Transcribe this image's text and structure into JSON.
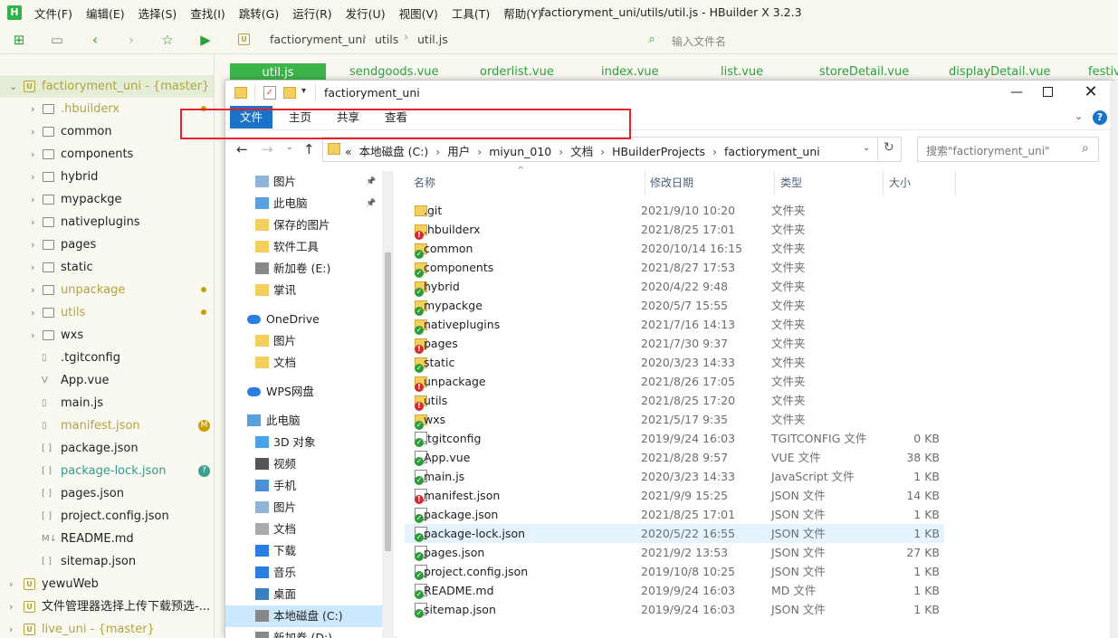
{
  "hbuilder": {
    "menu": [
      "文件(F)",
      "编辑(E)",
      "选择(S)",
      "查找(I)",
      "跳转(G)",
      "运行(R)",
      "发行(U)",
      "视图(V)",
      "工具(T)",
      "帮助(Y)"
    ],
    "title": "factioryment_uni/utils/util.js - HBuilder X 3.2.3",
    "breadcrumb": [
      "factioryment_uni",
      "utils",
      "util.js"
    ],
    "file_search_placeholder": "输入文件名",
    "editor_tabs": [
      "util.js",
      "sendgoods.vue",
      "orderlist.vue",
      "index.vue",
      "list.vue",
      "storeDetail.vue",
      "displayDetail.vue",
      "festiv"
    ],
    "sidebar": [
      {
        "label": "factioryment_uni - {master}",
        "kind": "project",
        "open": true,
        "color": "#b3a33f",
        "indent": 0
      },
      {
        "label": ".hbuilderx",
        "kind": "folder",
        "indent": 1,
        "dot": true,
        "color": "#b3a33f"
      },
      {
        "label": "common",
        "kind": "folder",
        "indent": 1
      },
      {
        "label": "components",
        "kind": "folder",
        "indent": 1
      },
      {
        "label": "hybrid",
        "kind": "folder",
        "indent": 1
      },
      {
        "label": "mypackge",
        "kind": "folder",
        "indent": 1
      },
      {
        "label": "nativeplugins",
        "kind": "folder",
        "indent": 1
      },
      {
        "label": "pages",
        "kind": "folder",
        "indent": 1
      },
      {
        "label": "static",
        "kind": "folder",
        "indent": 1
      },
      {
        "label": "unpackage",
        "kind": "folder",
        "indent": 1,
        "dot": true,
        "color": "#b3a33f"
      },
      {
        "label": "utils",
        "kind": "folder",
        "indent": 1,
        "dot": true,
        "color": "#b3a33f"
      },
      {
        "label": "wxs",
        "kind": "folder",
        "indent": 1
      },
      {
        "label": ".tgitconfig",
        "kind": "file",
        "indent": 1
      },
      {
        "label": "App.vue",
        "kind": "file",
        "indent": 1,
        "glyph": "V"
      },
      {
        "label": "main.js",
        "kind": "file",
        "indent": 1
      },
      {
        "label": "manifest.json",
        "kind": "file",
        "indent": 1,
        "color": "#b3a33f",
        "badge": "M",
        "badge_color": "#c8a000"
      },
      {
        "label": "package.json",
        "kind": "file",
        "indent": 1,
        "glyph": "[ ]"
      },
      {
        "label": "package-lock.json",
        "kind": "file",
        "indent": 1,
        "glyph": "[ ]",
        "color": "#2e9a8a",
        "badge": "?",
        "badge_color": "#3aa090"
      },
      {
        "label": "pages.json",
        "kind": "file",
        "indent": 1,
        "glyph": "[ ]"
      },
      {
        "label": "project.config.json",
        "kind": "file",
        "indent": 1,
        "glyph": "[ ]"
      },
      {
        "label": "README.md",
        "kind": "file",
        "indent": 1,
        "glyph": "M↓"
      },
      {
        "label": "sitemap.json",
        "kind": "file",
        "indent": 1,
        "glyph": "[ ]"
      },
      {
        "label": "yewuWeb",
        "kind": "project",
        "indent": 0
      },
      {
        "label": "文件管理器选择上传下载预选-...",
        "kind": "project",
        "indent": 0
      },
      {
        "label": "live_uni - {master}",
        "kind": "project",
        "indent": 0,
        "color": "#b3a33f"
      }
    ]
  },
  "explorer": {
    "title": "factioryment_uni",
    "ribbon_tabs": [
      "文件",
      "主页",
      "共享",
      "查看"
    ],
    "path": [
      "« ",
      "本地磁盘 (C:)",
      "用户",
      "miyun_010",
      "文档",
      "HBuilderProjects",
      "factioryment_uni"
    ],
    "search_placeholder": "搜索\"factioryment_uni\"",
    "columns": {
      "name": "名称",
      "date": "修改日期",
      "type": "类型",
      "size": "大小"
    },
    "nav": [
      {
        "label": "图片",
        "icon": "pictures-icon",
        "indent": 1,
        "pin": true
      },
      {
        "label": "此电脑",
        "icon": "pc-icon",
        "indent": 1,
        "pin": true
      },
      {
        "label": "保存的图片",
        "icon": "folder-icon",
        "indent": 1
      },
      {
        "label": "软件工具",
        "icon": "folder-icon",
        "indent": 1
      },
      {
        "label": "新加卷 (E:)",
        "icon": "drive-icon",
        "indent": 1
      },
      {
        "label": "掌讯",
        "icon": "folder-icon",
        "indent": 1
      },
      {
        "label": "OneDrive",
        "icon": "cloud-icon",
        "indent": 0,
        "gap": true
      },
      {
        "label": "图片",
        "icon": "folder-icon",
        "indent": 1
      },
      {
        "label": "文档",
        "icon": "folder-icon",
        "indent": 1
      },
      {
        "label": "WPS网盘",
        "icon": "cloud-icon",
        "indent": 0,
        "gap": true
      },
      {
        "label": "此电脑",
        "icon": "pc-icon",
        "indent": 0,
        "gap": true
      },
      {
        "label": "3D 对象",
        "icon": "3d-icon",
        "indent": 1
      },
      {
        "label": "视频",
        "icon": "video-icon",
        "indent": 1
      },
      {
        "label": "手机",
        "icon": "phone-icon",
        "indent": 1
      },
      {
        "label": "图片",
        "icon": "pictures-icon",
        "indent": 1
      },
      {
        "label": "文档",
        "icon": "document-icon",
        "indent": 1
      },
      {
        "label": "下载",
        "icon": "download-icon",
        "indent": 1
      },
      {
        "label": "音乐",
        "icon": "music-icon",
        "indent": 1
      },
      {
        "label": "桌面",
        "icon": "desktop-icon",
        "indent": 1
      },
      {
        "label": "本地磁盘 (C:)",
        "icon": "drive-icon",
        "indent": 1,
        "selected": true
      },
      {
        "label": "新加卷 (D:)",
        "icon": "drive-icon",
        "indent": 1
      }
    ],
    "files": [
      {
        "name": ".git",
        "date": "2021/9/10 10:20",
        "type": "文件夹",
        "size": "",
        "kind": "folder",
        "status": "none"
      },
      {
        "name": ".hbuilderx",
        "date": "2021/8/25 17:01",
        "type": "文件夹",
        "size": "",
        "kind": "folder",
        "status": "modified"
      },
      {
        "name": "common",
        "date": "2020/10/14 16:15",
        "type": "文件夹",
        "size": "",
        "kind": "folder",
        "status": "ok"
      },
      {
        "name": "components",
        "date": "2021/8/27 17:53",
        "type": "文件夹",
        "size": "",
        "kind": "folder",
        "status": "ok"
      },
      {
        "name": "hybrid",
        "date": "2020/4/22 9:48",
        "type": "文件夹",
        "size": "",
        "kind": "folder",
        "status": "ok"
      },
      {
        "name": "mypackge",
        "date": "2020/5/7 15:55",
        "type": "文件夹",
        "size": "",
        "kind": "folder",
        "status": "ok"
      },
      {
        "name": "nativeplugins",
        "date": "2021/7/16 14:13",
        "type": "文件夹",
        "size": "",
        "kind": "folder",
        "status": "ok"
      },
      {
        "name": "pages",
        "date": "2021/7/30 9:37",
        "type": "文件夹",
        "size": "",
        "kind": "folder",
        "status": "modified"
      },
      {
        "name": "static",
        "date": "2020/3/23 14:33",
        "type": "文件夹",
        "size": "",
        "kind": "folder",
        "status": "ok"
      },
      {
        "name": "unpackage",
        "date": "2021/8/26 17:05",
        "type": "文件夹",
        "size": "",
        "kind": "folder",
        "status": "modified"
      },
      {
        "name": "utils",
        "date": "2021/8/25 17:20",
        "type": "文件夹",
        "size": "",
        "kind": "folder",
        "status": "modified"
      },
      {
        "name": "wxs",
        "date": "2021/5/17 9:35",
        "type": "文件夹",
        "size": "",
        "kind": "folder",
        "status": "ok"
      },
      {
        "name": ".tgitconfig",
        "date": "2019/9/24 16:03",
        "type": "TGITCONFIG 文件",
        "size": "0 KB",
        "kind": "file",
        "status": "ok"
      },
      {
        "name": "App.vue",
        "date": "2021/8/28 9:57",
        "type": "VUE 文件",
        "size": "38 KB",
        "kind": "file",
        "status": "ok"
      },
      {
        "name": "main.js",
        "date": "2020/3/23 14:33",
        "type": "JavaScript 文件",
        "size": "1 KB",
        "kind": "file",
        "status": "ok"
      },
      {
        "name": "manifest.json",
        "date": "2021/9/9 15:25",
        "type": "JSON 文件",
        "size": "14 KB",
        "kind": "file",
        "status": "modified"
      },
      {
        "name": "package.json",
        "date": "2021/8/25 17:01",
        "type": "JSON 文件",
        "size": "1 KB",
        "kind": "file",
        "status": "ok"
      },
      {
        "name": "package-lock.json",
        "date": "2020/5/22 16:55",
        "type": "JSON 文件",
        "size": "1 KB",
        "kind": "file",
        "status": "added",
        "hover": true
      },
      {
        "name": "pages.json",
        "date": "2021/9/2 13:53",
        "type": "JSON 文件",
        "size": "27 KB",
        "kind": "file",
        "status": "ok"
      },
      {
        "name": "project.config.json",
        "date": "2019/10/8 10:25",
        "type": "JSON 文件",
        "size": "1 KB",
        "kind": "file",
        "status": "ok"
      },
      {
        "name": "README.md",
        "date": "2019/9/24 16:03",
        "type": "MD 文件",
        "size": "1 KB",
        "kind": "file",
        "status": "ok"
      },
      {
        "name": "sitemap.json",
        "date": "2019/9/24 16:03",
        "type": "JSON 文件",
        "size": "1 KB",
        "kind": "file",
        "status": "ok"
      }
    ],
    "colors": {
      "ok": "#2e9b3a",
      "modified": "#d6292f",
      "added": "#2e9b3a",
      "folder": "#f3cf5f",
      "accent": "#1a73c8"
    }
  }
}
